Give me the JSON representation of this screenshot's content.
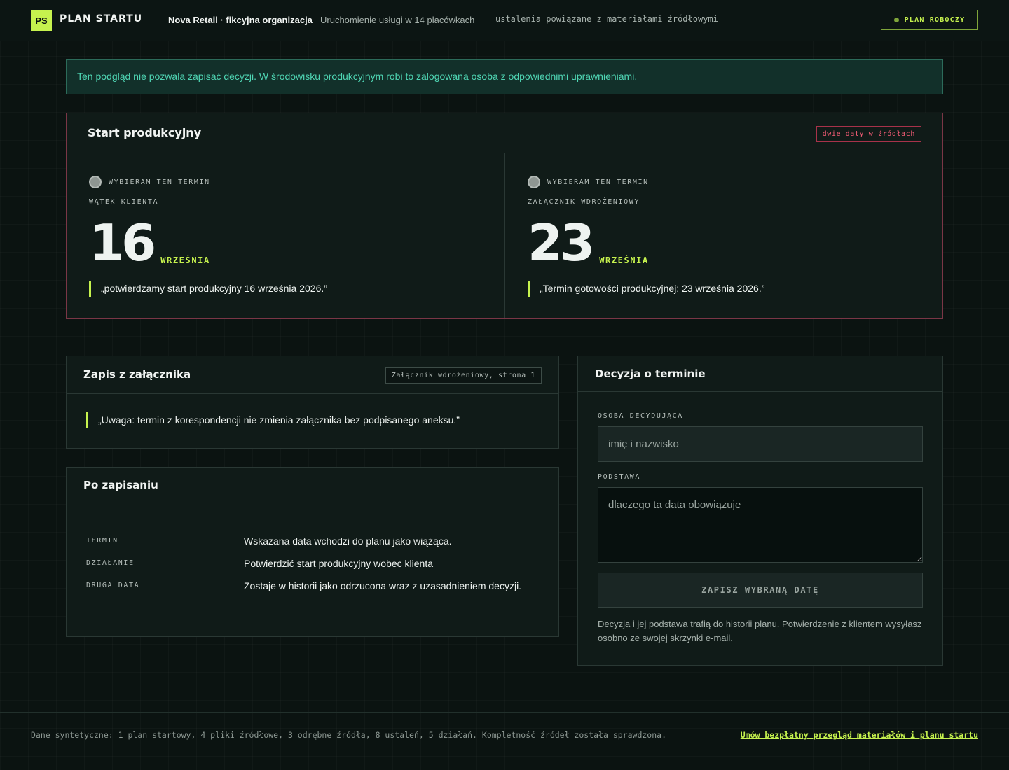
{
  "header": {
    "logo": "PS",
    "brand": "PLAN STARTU",
    "organization": "Nova Retail · fikcyjna organizacja",
    "subtitle": "Uruchomienie usługi w 14 placówkach",
    "tagline": "ustalenia powiązane z materiałami źródłowymi",
    "status_badge": "PLAN ROBOCZY"
  },
  "notice": "Ten podgląd nie pozwala zapisać decyzji. W środowisku produkcyjnym robi to zalogowana osoba z odpowiednimi uprawnieniami.",
  "conflict": {
    "title": "Start produkcyjny",
    "badge": "dwie daty w źródłach",
    "options": [
      {
        "choose_label": "WYBIERAM TEN TERMIN",
        "source": "WĄTEK KLIENTA",
        "day": "16",
        "month": "WRZEŚNIA",
        "quote": "„potwierdzamy start produkcyjny 16 września 2026.”"
      },
      {
        "choose_label": "WYBIERAM TEN TERMIN",
        "source": "ZAŁĄCZNIK WDROŻENIOWY",
        "day": "23",
        "month": "WRZEŚNIA",
        "quote": "„Termin gotowości produkcyjnej: 23 września 2026.”"
      }
    ]
  },
  "attachment": {
    "title": "Zapis z załącznika",
    "badge": "Załącznik wdrożeniowy, strona 1",
    "quote": "„Uwaga: termin z korespondencji nie zmienia załącznika bez podpisanego aneksu.”"
  },
  "after_save": {
    "title": "Po zapisaniu",
    "rows": [
      {
        "key": "TERMIN",
        "value": "Wskazana data wchodzi do planu jako wiążąca."
      },
      {
        "key": "DZIAŁANIE",
        "value": "Potwierdzić start produkcyjny wobec klienta"
      },
      {
        "key": "DRUGA DATA",
        "value": "Zostaje w historii jako odrzucona wraz z uzasadnieniem decyzji."
      }
    ]
  },
  "decision": {
    "title": "Decyzja o terminie",
    "person_label": "OSOBA DECYDUJĄCA",
    "person_placeholder": "imię i nazwisko",
    "reason_label": "PODSTAWA",
    "reason_placeholder": "dlaczego ta data obowiązuje",
    "save_button": "ZAPISZ WYBRANĄ DATĘ",
    "note": "Decyzja i jej podstawa trafią do historii planu. Potwierdzenie z klientem wysyłasz osobno ze swojej skrzynki e-mail."
  },
  "footer": {
    "text": "Dane syntetyczne: 1 plan startowy, 4 pliki źródłowe, 3 odrębne źródła, 8 ustaleń, 5 działań. Kompletność źródeł została sprawdzona.",
    "link": "Umów bezpłatny przegląd materiałów i planu startu"
  }
}
